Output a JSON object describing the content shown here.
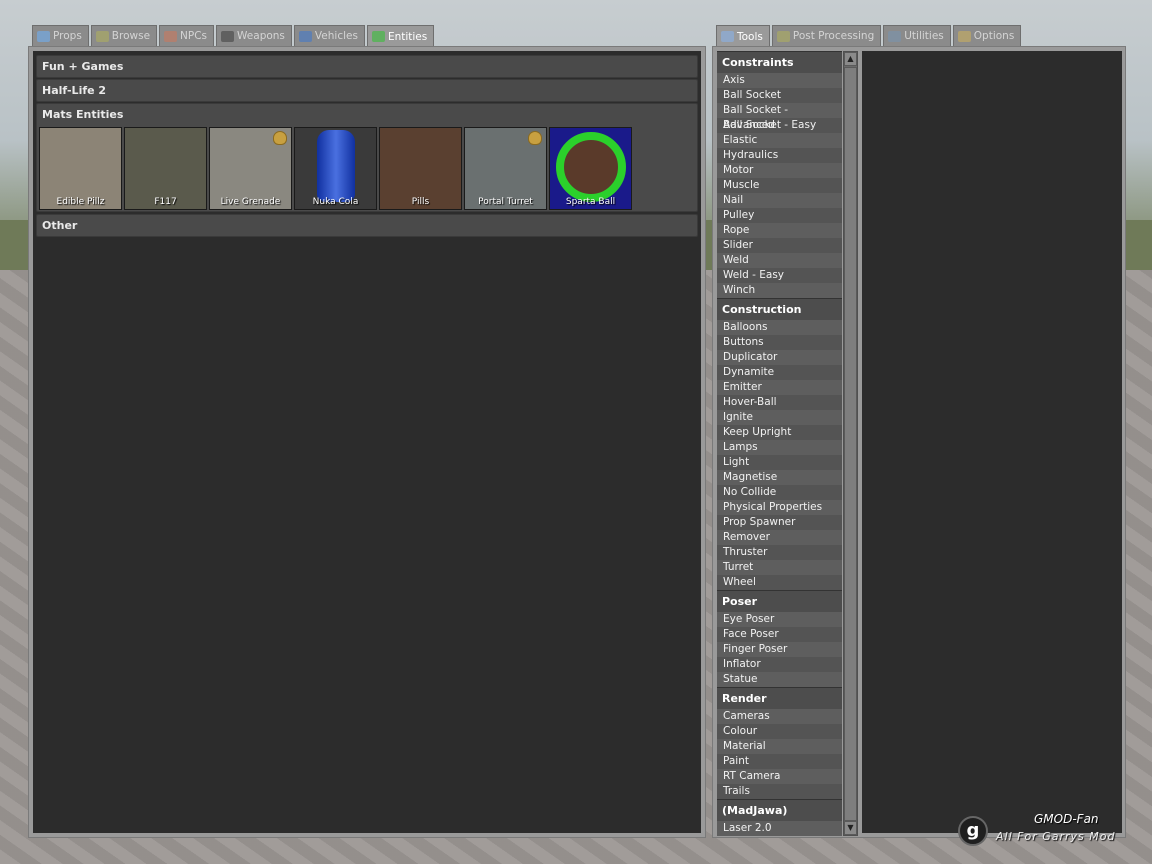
{
  "left_tabs": [
    {
      "label": "Props",
      "icon": "props-icon",
      "color": "#7aa0c8"
    },
    {
      "label": "Browse",
      "icon": "browse-icon",
      "color": "#a0a070"
    },
    {
      "label": "NPCs",
      "icon": "npcs-icon",
      "color": "#b08070"
    },
    {
      "label": "Weapons",
      "icon": "weapons-icon",
      "color": "#606060"
    },
    {
      "label": "Vehicles",
      "icon": "vehicles-icon",
      "color": "#6080b0"
    },
    {
      "label": "Entities",
      "icon": "entities-icon",
      "color": "#60b060"
    }
  ],
  "right_tabs": [
    {
      "label": "Tools",
      "icon": "wrench-icon",
      "color": "#90a8c8"
    },
    {
      "label": "Post Processing",
      "icon": "post-processing-icon",
      "color": "#a0a070"
    },
    {
      "label": "Utilities",
      "icon": "utilities-icon",
      "color": "#8090a0"
    },
    {
      "label": "Options",
      "icon": "options-icon",
      "color": "#b0a070"
    }
  ],
  "categories": {
    "fun_games": "Fun + Games",
    "half_life": "Half-Life 2",
    "mats": "Mats Entities",
    "other": "Other"
  },
  "entities": [
    {
      "label": "Edible Pillz",
      "bg": "#8c8476"
    },
    {
      "label": "F117",
      "bg": "#5a5a4c"
    },
    {
      "label": "Live Grenade",
      "bg": "#8a8880"
    },
    {
      "label": "Nuka Cola",
      "bg": "#3a3a3a"
    },
    {
      "label": "Pills",
      "bg": "#5a4030"
    },
    {
      "label": "Portal Turret",
      "bg": "#6a7070"
    },
    {
      "label": "Sparta Ball",
      "bg": "#1a1a8a"
    }
  ],
  "tool_groups": [
    {
      "header": "Constraints",
      "items": [
        "Axis",
        "Ball Socket",
        "Ball Socket - Advanced",
        "Ball Socket - Easy",
        "Elastic",
        "Hydraulics",
        "Motor",
        "Muscle",
        "Nail",
        "Pulley",
        "Rope",
        "Slider",
        "Weld",
        "Weld - Easy",
        "Winch"
      ]
    },
    {
      "header": "Construction",
      "items": [
        "Balloons",
        "Buttons",
        "Duplicator",
        "Dynamite",
        "Emitter",
        "Hover-Ball",
        "Ignite",
        "Keep Upright",
        "Lamps",
        "Light",
        "Magnetise",
        "No Collide",
        "Physical Properties",
        "Prop Spawner",
        "Remover",
        "Thruster",
        "Turret",
        "Wheel"
      ]
    },
    {
      "header": "Poser",
      "items": [
        "Eye Poser",
        "Face Poser",
        "Finger Poser",
        "Inflator",
        "Statue"
      ]
    },
    {
      "header": "Render",
      "items": [
        "Cameras",
        "Colour",
        "Material",
        "Paint",
        "RT Camera",
        "Trails"
      ]
    },
    {
      "header": "(MadJawa)",
      "items": [
        "Laser 2.0"
      ]
    }
  ],
  "watermark": {
    "logo": "g",
    "line1": "GMOD-Fan",
    "line2": "All For Garrys Mod"
  }
}
